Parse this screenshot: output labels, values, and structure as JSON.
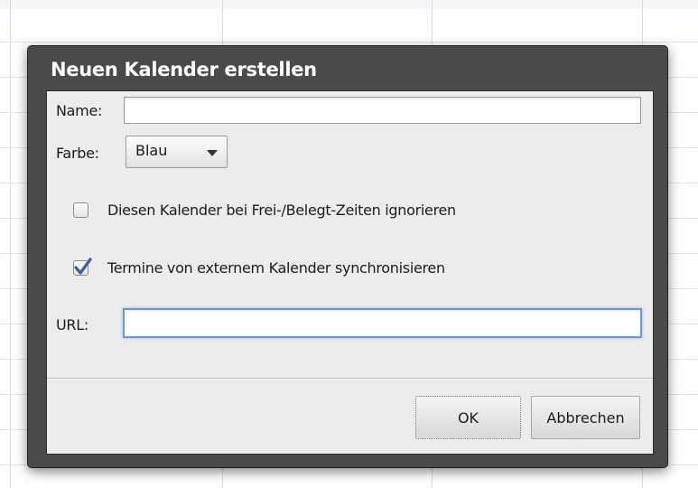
{
  "dialog": {
    "title": "Neuen Kalender erstellen"
  },
  "form": {
    "name_label": "Name:",
    "name_value": "",
    "color_label": "Farbe:",
    "color_value": "Blau",
    "ignore_freebusy_label": "Diesen Kalender bei Frei-/Belegt-Zeiten ignorieren",
    "ignore_freebusy_checked": false,
    "sync_external_label": "Termine von externem Kalender synchronisieren",
    "sync_external_checked": true,
    "url_label": "URL:",
    "url_value": ""
  },
  "buttons": {
    "ok_label": "OK",
    "cancel_label": "Abbrechen"
  },
  "icons": {
    "color_dropdown": "chevron-down-icon",
    "checkmark": "checkmark-icon"
  },
  "colors": {
    "dialog_frame": "#4a4a4a",
    "panel_background": "#ececec",
    "focus_ring": "#6b9ad6",
    "checkmark": "#3a5fa8"
  }
}
